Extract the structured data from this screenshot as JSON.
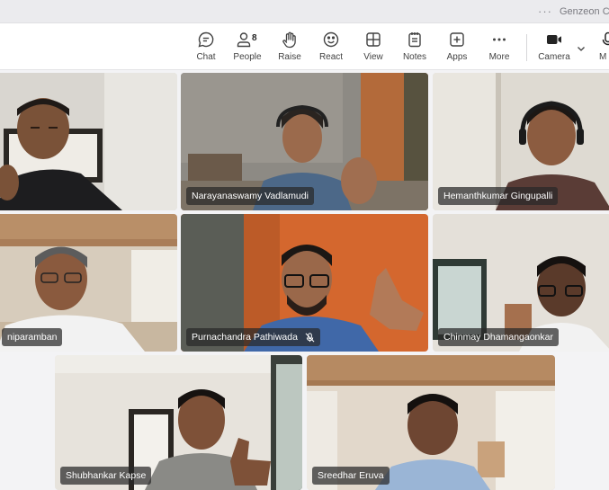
{
  "window": {
    "title_truncated": "Genzeon Co"
  },
  "toolbar": {
    "items": [
      {
        "label": "Chat",
        "icon": "chat-icon"
      },
      {
        "label": "People",
        "icon": "people-icon",
        "count": "8"
      },
      {
        "label": "Raise",
        "icon": "hand-icon"
      },
      {
        "label": "React",
        "icon": "smile-icon"
      },
      {
        "label": "View",
        "icon": "grid-view-icon"
      },
      {
        "label": "Notes",
        "icon": "notes-icon"
      },
      {
        "label": "Apps",
        "icon": "apps-plus-icon"
      },
      {
        "label": "More",
        "icon": "more-dots-icon"
      },
      {
        "label": "Camera",
        "icon": "camera-icon"
      },
      {
        "label": "M",
        "icon": "mic-icon"
      }
    ]
  },
  "participants": [
    {
      "name": "",
      "muted": false
    },
    {
      "name": "Narayanaswamy Vadlamudi",
      "muted": false
    },
    {
      "name": "Hemanthkumar Gingupalli",
      "muted": false
    },
    {
      "name": "niparamban",
      "muted": false
    },
    {
      "name": "Purnachandra Pathiwada",
      "muted": true
    },
    {
      "name": "Chinmay Dhamangaonkar",
      "muted": false
    },
    {
      "name": "Shubhankar Kapse",
      "muted": false
    },
    {
      "name": "Sreedhar Eruva",
      "muted": false
    }
  ],
  "colors": {
    "toolbar_bg": "#ffffff",
    "grid_bg": "#f3f3f5",
    "nametag_bg": "rgba(40,40,40,0.72)"
  }
}
